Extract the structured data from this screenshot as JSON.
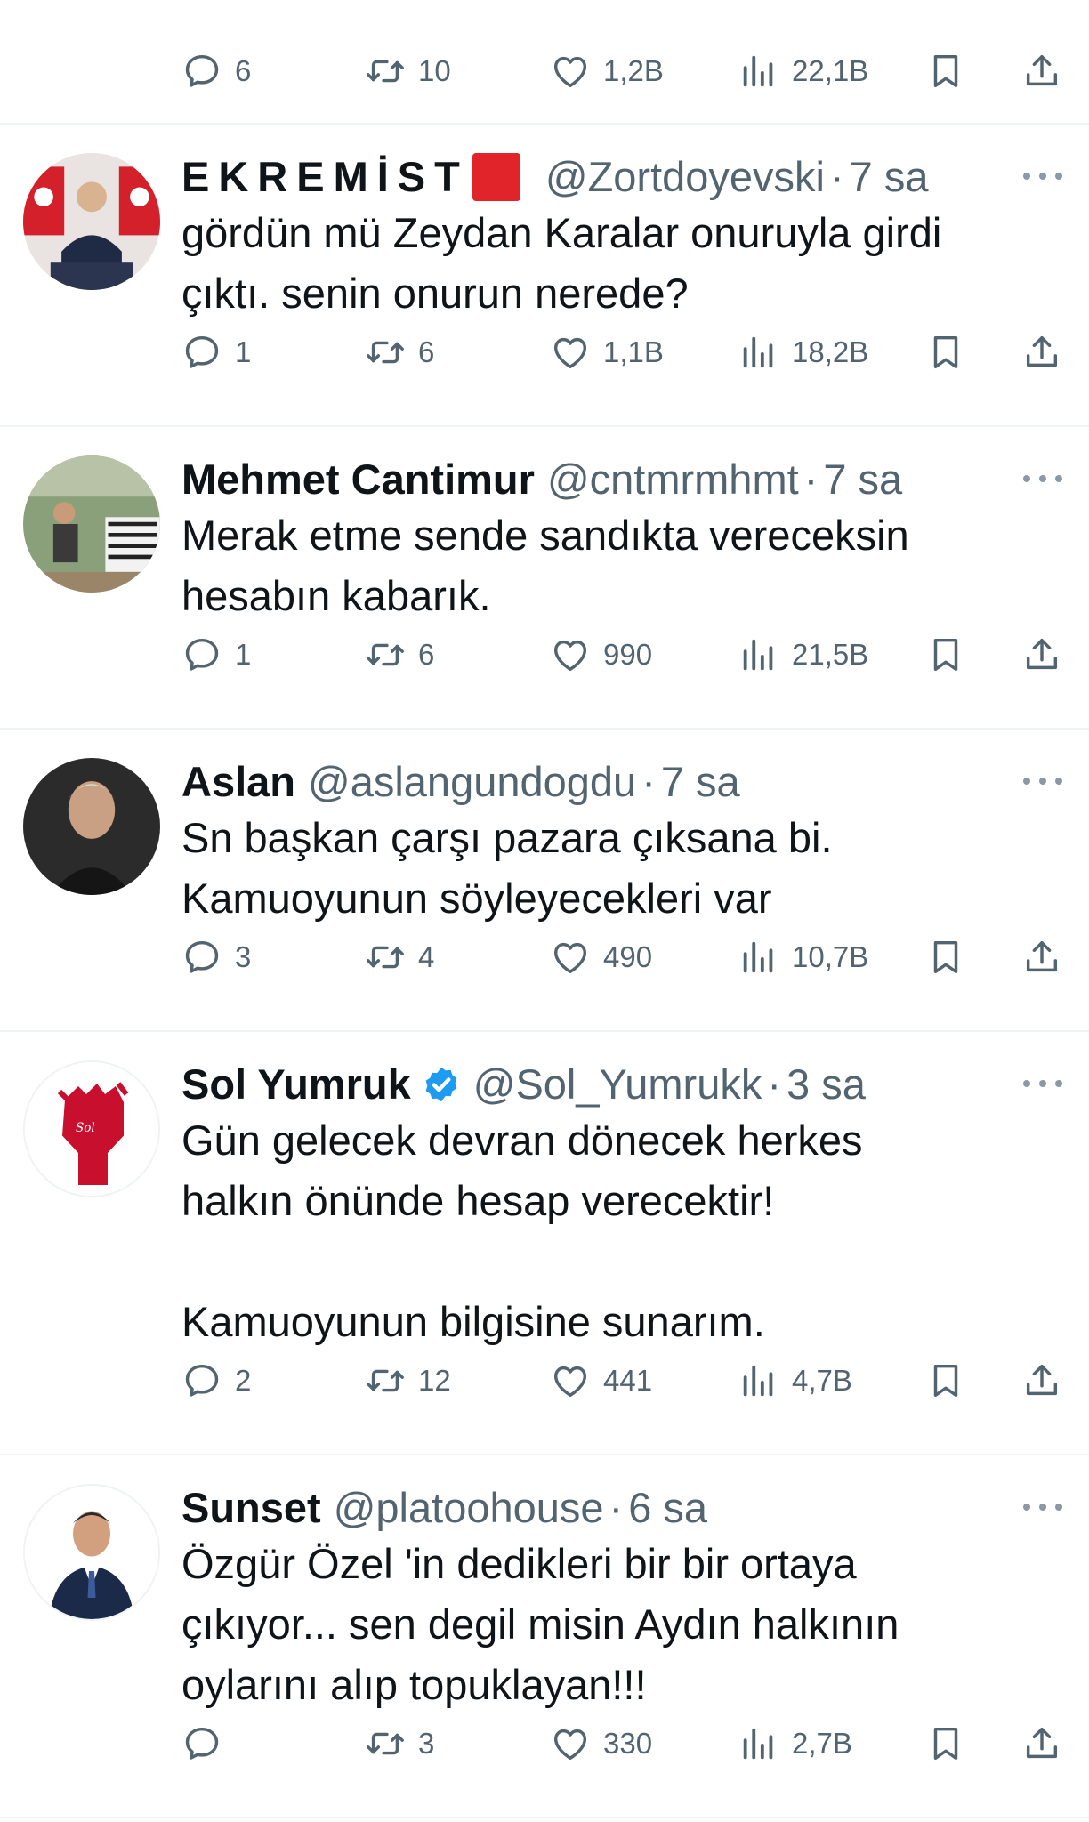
{
  "top_actions": {
    "replies": "6",
    "retweets": "10",
    "likes": "1,2B",
    "views": "22,1B"
  },
  "tweets": [
    {
      "name": "EKREMİST",
      "handle": "@Zortdoyevski",
      "time": "7 sa",
      "text": [
        "gördün mü Zeydan Karalar onuruyla girdi",
        "çıktı. senin onurun nerede?"
      ],
      "replies": "1",
      "retweets": "6",
      "likes": "1,1B",
      "views": "18,2B"
    },
    {
      "name": "Mehmet Cantimur",
      "handle": "@cntmrmhmt",
      "time": "7 sa",
      "text": [
        "Merak etme sende sandıkta vereceksin",
        "hesabın kabarık."
      ],
      "replies": "1",
      "retweets": "6",
      "likes": "990",
      "views": "21,5B"
    },
    {
      "name": "Aslan",
      "handle": "@aslangundogdu",
      "time": "7 sa",
      "text": [
        "Sn başkan çarşı pazara çıksana bi.",
        "Kamuoyunun söyleyecekleri var"
      ],
      "replies": "3",
      "retweets": "4",
      "likes": "490",
      "views": "10,7B"
    },
    {
      "name": "Sol Yumruk",
      "handle": "@Sol_Yumrukk",
      "time": "3 sa",
      "text": [
        "Gün gelecek devran dönecek herkes",
        "halkın önünde hesap verecektir!",
        "",
        "Kamuoyunun bilgisine sunarım."
      ],
      "replies": "2",
      "retweets": "12",
      "likes": "441",
      "views": "4,7B"
    },
    {
      "name": "Sunset",
      "handle": "@platoohouse",
      "time": "6 sa",
      "text": [
        "Özgür Özel 'in dedikleri bir bir ortaya",
        "çıkıyor... sen degil misin Aydın halkının",
        "oylarını alıp topuklayan!!!"
      ],
      "replies": "",
      "retweets": "3",
      "likes": "330",
      "views": "2,7B"
    }
  ],
  "colors": {
    "muted": "#536471",
    "divider": "#eff3f4",
    "verified": "#1d9bf0",
    "flag": "#e0242a"
  },
  "icons": [
    "reply-icon",
    "retweet-icon",
    "like-icon",
    "views-icon",
    "bookmark-icon",
    "share-icon",
    "more-icon",
    "verified-badge-icon"
  ]
}
